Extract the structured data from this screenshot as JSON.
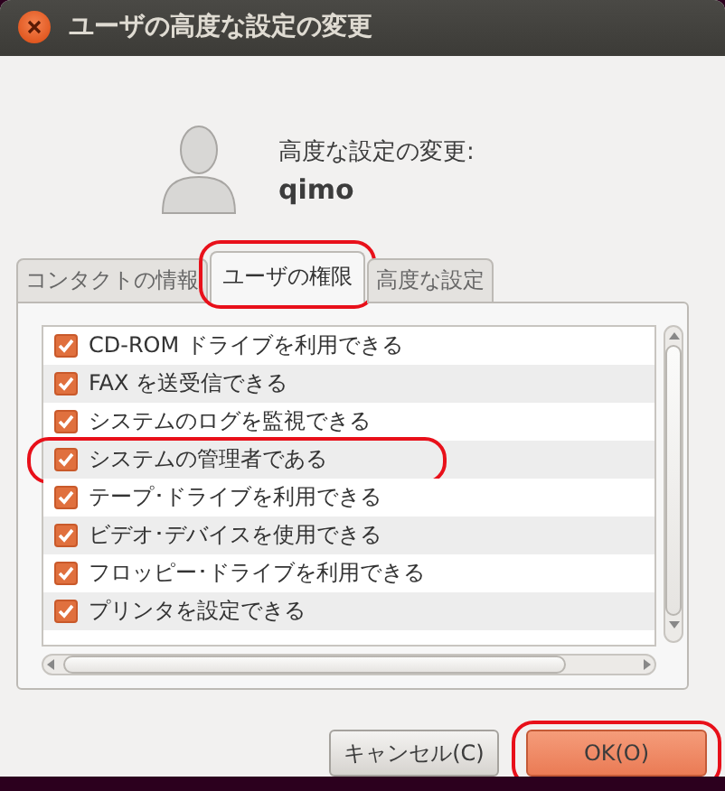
{
  "window": {
    "title": "ユーザの高度な設定の変更"
  },
  "header": {
    "heading": "高度な設定の変更:",
    "user": "qimo"
  },
  "tabs": [
    {
      "label": "コンタクトの情報",
      "selected": false,
      "highlighted": false
    },
    {
      "label": "ユーザの権限",
      "selected": true,
      "highlighted": true
    },
    {
      "label": "高度な設定",
      "selected": false,
      "highlighted": false
    }
  ],
  "privileges": [
    {
      "label": "CD-ROM ドライブを利用できる",
      "checked": true,
      "highlighted": false
    },
    {
      "label": "FAX を送受信できる",
      "checked": true,
      "highlighted": false
    },
    {
      "label": "システムのログを監視できる",
      "checked": true,
      "highlighted": false
    },
    {
      "label": "システムの管理者である",
      "checked": true,
      "highlighted": true
    },
    {
      "label": "テープ･ドライブを利用できる",
      "checked": true,
      "highlighted": false
    },
    {
      "label": "ビデオ･デバイスを使用できる",
      "checked": true,
      "highlighted": false
    },
    {
      "label": "フロッピー･ドライブを利用できる",
      "checked": true,
      "highlighted": false
    },
    {
      "label": "プリンタを設定できる",
      "checked": true,
      "highlighted": false
    }
  ],
  "buttons": [
    {
      "label": "キャンセル(C)",
      "kind": "normal",
      "highlighted": false
    },
    {
      "label": "OK(O)",
      "kind": "default",
      "highlighted": true
    }
  ]
}
